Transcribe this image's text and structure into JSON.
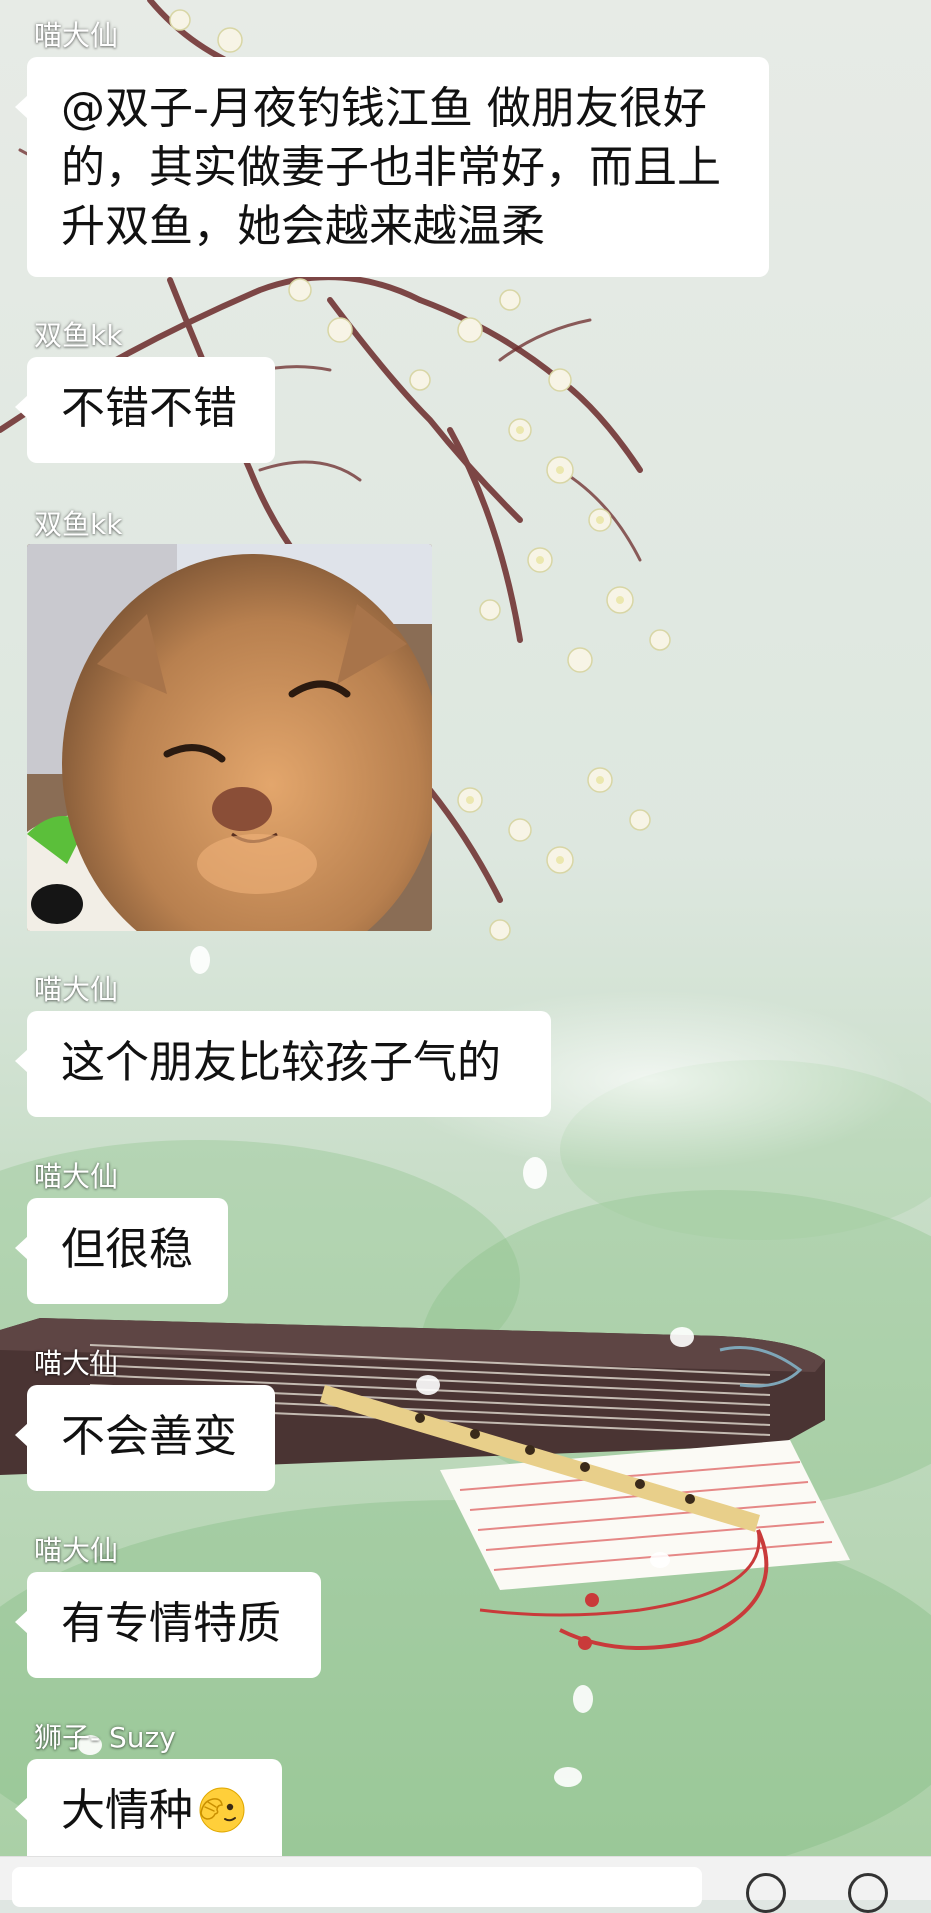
{
  "messages": [
    {
      "sender": "喵大仙",
      "lines": [
        "@双子-月夜钓钱江鱼  做朋友很好",
        "的，其实做妻子也非常好，而且上",
        "升双鱼，她会越来越温柔"
      ]
    },
    {
      "sender": "双鱼kk",
      "text": "不错不错"
    },
    {
      "sender": "双鱼kk",
      "image": "cat-photo"
    },
    {
      "sender": "喵大仙",
      "text": "这个朋友比较孩子气的"
    },
    {
      "sender": "喵大仙",
      "text": "但很稳"
    },
    {
      "sender": "喵大仙",
      "text": "不会善变"
    },
    {
      "sender": "喵大仙",
      "text": "有专情特质"
    },
    {
      "sender": "狮子- Suzy",
      "text": "大情种",
      "emoji": "face-with-hand-over-eye-emoji"
    }
  ],
  "colors": {
    "bubble": "#ffffff",
    "sender_text": "#ffffff",
    "message_text": "#111111"
  }
}
